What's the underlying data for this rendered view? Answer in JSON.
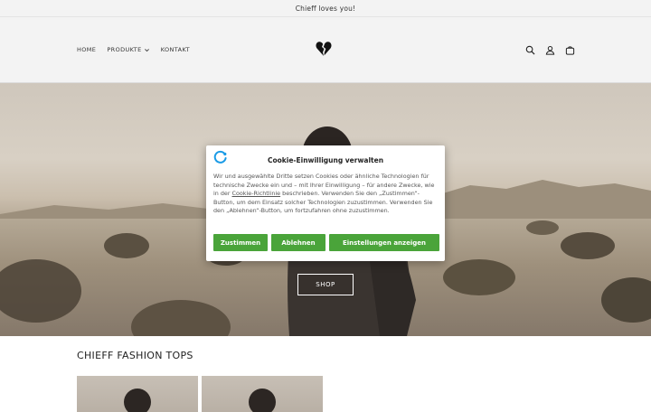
{
  "announcement": {
    "text": "Chieff loves you!"
  },
  "nav": {
    "items": [
      {
        "label": "HOME"
      },
      {
        "label": "PRODUKTE"
      },
      {
        "label": "KONTAKT"
      }
    ]
  },
  "header_icons": [
    "search-icon",
    "account-icon",
    "cart-icon"
  ],
  "hero": {
    "shop_label": "SHOP"
  },
  "cookie": {
    "title": "Cookie-Einwilligung verwalten",
    "text_1": "Wir und ausgewählte Dritte setzen Cookies oder ähnliche Technologien für technische Zwecke ein und – mit Ihrer Einwilligung – für andere Zwecke, wie in der ",
    "link": "Cookie-Richtlinie",
    "text_2": " beschrieben. Verwenden Sie den „Zustimmen“-Button, um dem Einsatz solcher Technologien zuzustimmen. Verwenden Sie den „Ablehnen“-Button, um fortzufahren ohne zuzustimmen.",
    "accept": "Zustimmen",
    "reject": "Ablehnen",
    "settings": "Einstellungen anzeigen",
    "accent_color": "#4aa43a"
  },
  "section": {
    "title": "CHIEFF FASHION TOPS"
  }
}
